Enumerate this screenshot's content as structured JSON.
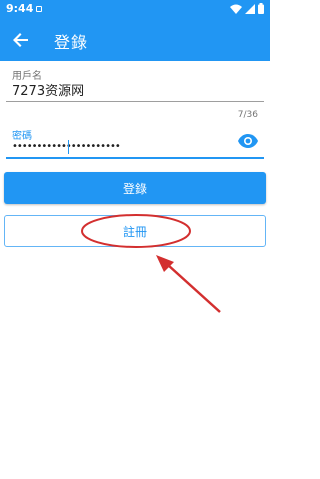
{
  "status_bar": {
    "time": "9:44",
    "background": "#2196F3"
  },
  "app_bar": {
    "title": "登錄",
    "back_icon": "arrow-left-icon"
  },
  "form": {
    "username": {
      "label": "用戶名",
      "value": "7273资源网"
    },
    "password": {
      "label": "密碼",
      "masked_value": "••••••••••••••••••••••",
      "counter": "7/36",
      "toggle_icon": "eye-icon"
    }
  },
  "buttons": {
    "login_label": "登錄",
    "register_label": "註冊"
  },
  "colors": {
    "primary": "#2196F3",
    "annotation": "#d32f2f"
  }
}
